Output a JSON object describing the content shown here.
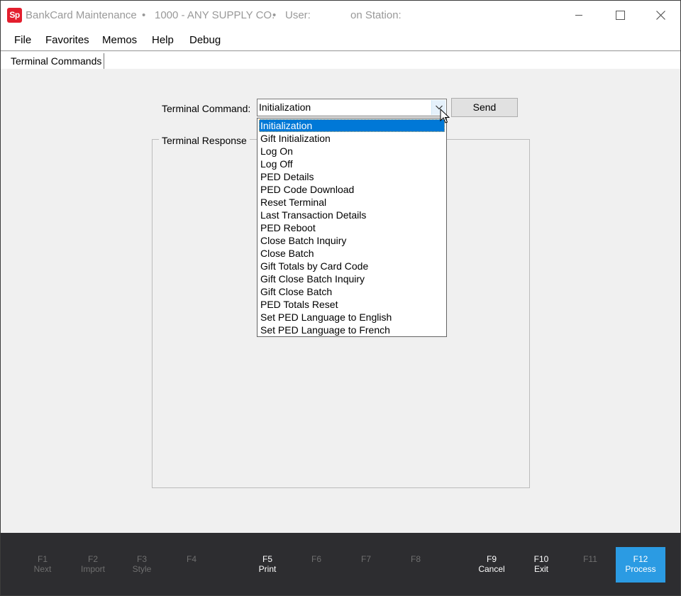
{
  "window": {
    "app_logo_text": "Sp",
    "app_name": "BankCard Maintenance",
    "separator": "•",
    "company": "1000 - ANY SUPPLY CO.",
    "user_label": "User:",
    "station_label": "on Station:"
  },
  "menu": {
    "file": "File",
    "favorites": "Favorites",
    "memos": "Memos",
    "help": "Help",
    "debug": "Debug"
  },
  "tab": {
    "label": "Terminal Commands"
  },
  "form": {
    "command_label": "Terminal Command:",
    "command_value": "Initialization",
    "send_label": "Send",
    "response_label": "Terminal Response"
  },
  "dropdown": {
    "items": [
      "Initialization",
      "Gift Initialization",
      "Log On",
      "Log Off",
      "PED Details",
      "PED Code Download",
      "Reset Terminal",
      "Last Transaction Details",
      "PED Reboot",
      "Close Batch Inquiry",
      "Close Batch",
      "Gift Totals by Card Code",
      "Gift Close Batch Inquiry",
      "Gift Close Batch",
      "PED Totals Reset",
      "Set PED Language to English",
      "Set PED Language to French"
    ],
    "selected_index": 0
  },
  "footer": {
    "keys": [
      {
        "key": "F1",
        "label": "Next",
        "state": "disabled"
      },
      {
        "key": "F2",
        "label": "Import",
        "state": "disabled"
      },
      {
        "key": "F3",
        "label": "Style",
        "state": "disabled"
      },
      {
        "key": "F4",
        "label": "",
        "state": "disabled"
      },
      {
        "key": "F5",
        "label": "Print",
        "state": "enabled"
      },
      {
        "key": "F6",
        "label": "",
        "state": "disabled"
      },
      {
        "key": "F7",
        "label": "",
        "state": "disabled"
      },
      {
        "key": "F8",
        "label": "",
        "state": "disabled"
      },
      {
        "key": "F9",
        "label": "Cancel",
        "state": "enabled"
      },
      {
        "key": "F10",
        "label": "Exit",
        "state": "enabled"
      },
      {
        "key": "F11",
        "label": "",
        "state": "disabled"
      },
      {
        "key": "F12",
        "label": "Process",
        "state": "primary"
      }
    ]
  },
  "colors": {
    "logo": "#e31e2d",
    "selection": "#0078d7",
    "footer_bg": "#2d2d30",
    "primary_key": "#2b9be3"
  }
}
